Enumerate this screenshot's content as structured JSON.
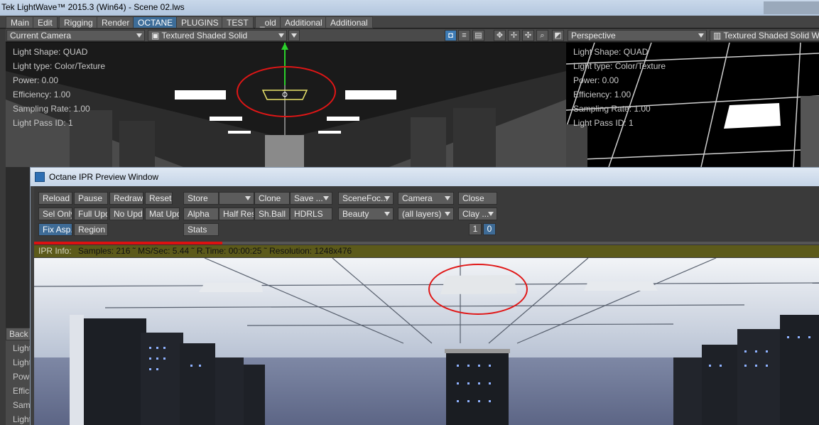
{
  "window": {
    "title": "Tek LightWave™ 2015.3 (Win64) - Scene 02.lws"
  },
  "menu_tabs": [
    "Main",
    "Edit",
    "Rigging",
    "Render",
    "OCTANE",
    "PLUGINS",
    "TEST",
    "_old",
    "Additional",
    "Additional"
  ],
  "active_tab": "OCTANE",
  "viewport_left": {
    "camera": "Current Camera",
    "shading": "Textured Shaded Solid",
    "overlay": [
      "Light Shape: QUAD",
      "Light type: Color/Texture",
      "Power: 0.00",
      "Efficiency: 1.00",
      "Sampling Rate: 1.00",
      "Light Pass ID: 1"
    ]
  },
  "viewport_right": {
    "camera": "Perspective",
    "shading": "Textured Shaded Solid Wirefr",
    "overlay": [
      "Light Shape: QUAD",
      "Light type: Color/Texture",
      "Power: 0.00",
      "Efficiency: 1.00",
      "Sampling Rate: 1.00",
      "Light Pass ID: 1"
    ]
  },
  "bottom_left": {
    "back_label": "Back",
    "lines": [
      "Light",
      "Light",
      "Powe",
      "Effici",
      "Samp",
      "Light"
    ]
  },
  "ipr": {
    "title": "Octane IPR Preview Window",
    "buttons": {
      "reload": "Reload",
      "pause": "Pause",
      "redraw": "Redraw",
      "reset": "Reset",
      "store": "Store",
      "store_select": "",
      "clone": "Clone",
      "save": "Save ...",
      "scenefoc": "SceneFoc...",
      "camera": "Camera",
      "close": "Close",
      "sel_only": "Sel Only",
      "full_upd": "Full Upd.",
      "no_upd": "No Upd.",
      "mat_upd": "Mat Upd",
      "alpha": "Alpha",
      "half_res": "Half Res",
      "sh_ball": "Sh.Ball",
      "hdrls": "HDRLS",
      "beauty": "Beauty",
      "all_layers": "(all layers)",
      "clay": "Clay ...",
      "fix_asp": "Fix Asp.",
      "region": "Region",
      "stats": "Stats"
    },
    "pages": [
      "1",
      "0"
    ],
    "progress": 0.24,
    "info": {
      "label": "IPR Info:",
      "samples": "Samples: 216",
      "ms_sec": "MS/Sec: 5.44",
      "r_time": "R.Time: 00:00:25",
      "resolution": "Resolution: 1248x476"
    }
  },
  "colors": {
    "accent": "#3d6d99",
    "highlight_ring": "#e01616",
    "info_bar": "#5c5a1a"
  }
}
